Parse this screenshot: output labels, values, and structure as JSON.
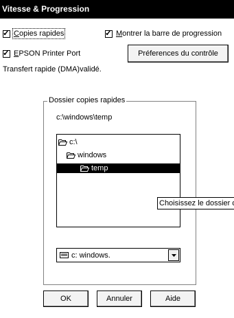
{
  "window": {
    "title": "Vitesse & Progression"
  },
  "options": {
    "copies_rapides": {
      "label": "Copies rapides",
      "checked": true
    },
    "montrer_barre": {
      "label": "Montrer la barre de progression",
      "checked": true
    },
    "epson_port": {
      "label": "EPSON Printer Port",
      "checked": true
    }
  },
  "preferences_button": {
    "label": "Préferences du contrôle"
  },
  "dma_status": "Transfert rapide (DMA)validé.",
  "folder_group": {
    "label": "Dossier copies rapides",
    "current_path": "c:\\windows\\temp",
    "tree": [
      {
        "label": "c:\\",
        "icon": "open-folder-icon",
        "selected": false
      },
      {
        "label": "windows",
        "icon": "open-folder-icon",
        "selected": false
      },
      {
        "label": "temp",
        "icon": "open-folder-icon",
        "selected": true
      }
    ],
    "tooltip": "Choisissez le dossier de",
    "drive_select": {
      "value": "c:  windows.",
      "icon": "drive-icon"
    }
  },
  "buttons": {
    "ok": "OK",
    "cancel": "Annuler",
    "help": "Aide"
  }
}
